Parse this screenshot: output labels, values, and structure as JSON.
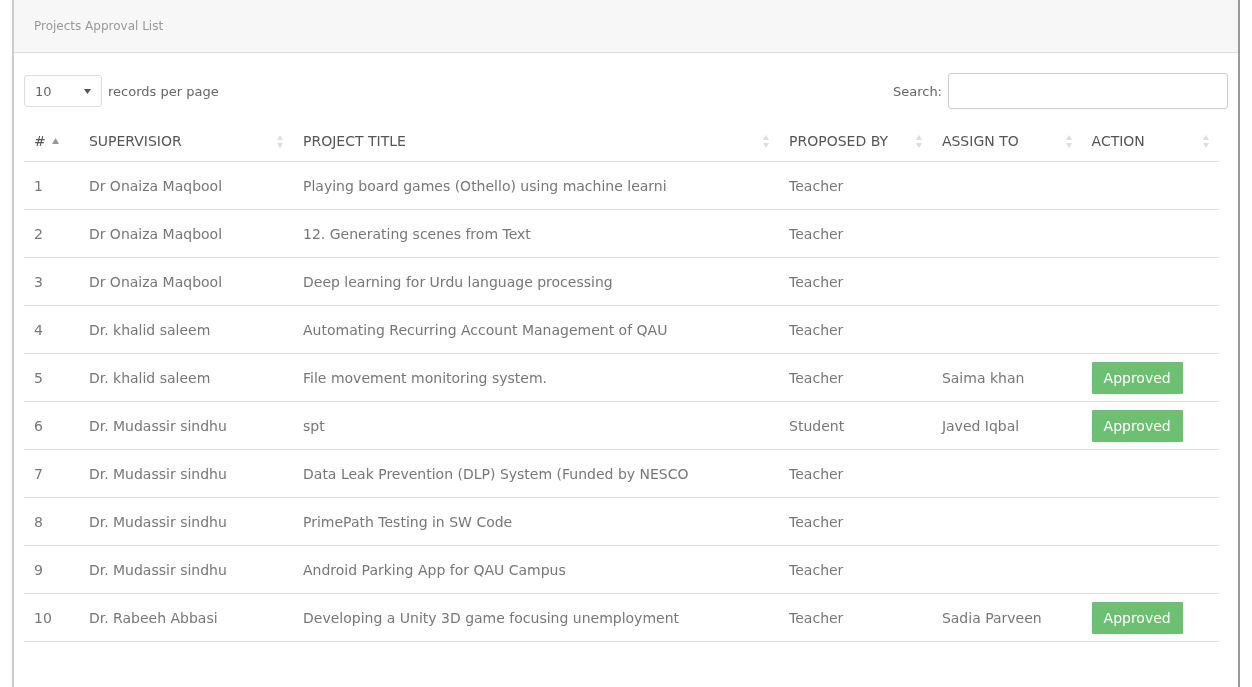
{
  "panel": {
    "title": "Projects Approval List"
  },
  "length_menu": {
    "value": "10",
    "label": "records per page"
  },
  "search": {
    "label": "Search:"
  },
  "table": {
    "columns": [
      {
        "label": "#",
        "sorted": true
      },
      {
        "label": "SUPERVISIOR",
        "sorted": false
      },
      {
        "label": "PROJECT TITLE",
        "sorted": false
      },
      {
        "label": "PROPOSED BY",
        "sorted": false
      },
      {
        "label": "ASSIGN TO",
        "sorted": false
      },
      {
        "label": "ACTION",
        "sorted": false
      }
    ],
    "rows": [
      {
        "no": "1",
        "supervisor": "Dr Onaiza Maqbool",
        "title": "Playing board games (Othello) using machine learni",
        "proposed_by": "Teacher"
      },
      {
        "no": "2",
        "supervisor": "Dr Onaiza Maqbool",
        "title": "12. Generating scenes from Text",
        "proposed_by": "Teacher"
      },
      {
        "no": "3",
        "supervisor": "Dr Onaiza Maqbool",
        "title": "Deep learning for Urdu language processing",
        "proposed_by": "Teacher"
      },
      {
        "no": "4",
        "supervisor": "Dr. khalid saleem",
        "title": "Automating Recurring Account Management of QAU",
        "proposed_by": "Teacher"
      },
      {
        "no": "5",
        "supervisor": "Dr. khalid saleem",
        "title": "File movement monitoring system.",
        "proposed_by": "Teacher",
        "assign_to": "Saima khan",
        "action": "Approved"
      },
      {
        "no": "6",
        "supervisor": "Dr. Mudassir sindhu",
        "title": "spt",
        "proposed_by": "Student",
        "assign_to": "Javed Iqbal",
        "action": "Approved"
      },
      {
        "no": "7",
        "supervisor": "Dr. Mudassir sindhu",
        "title": "Data Leak Prevention (DLP) System (Funded by NESCO",
        "proposed_by": "Teacher"
      },
      {
        "no": "8",
        "supervisor": "Dr. Mudassir sindhu",
        "title": "PrimePath Testing in SW Code",
        "proposed_by": "Teacher"
      },
      {
        "no": "9",
        "supervisor": "Dr. Mudassir sindhu",
        "title": "Android Parking App for QAU Campus",
        "proposed_by": "Teacher"
      },
      {
        "no": "10",
        "supervisor": "Dr. Rabeeh Abbasi",
        "title": "Developing a Unity 3D game focusing unemployment",
        "proposed_by": "Teacher",
        "assign_to": "Sadia Parveen",
        "action": "Approved"
      }
    ]
  }
}
